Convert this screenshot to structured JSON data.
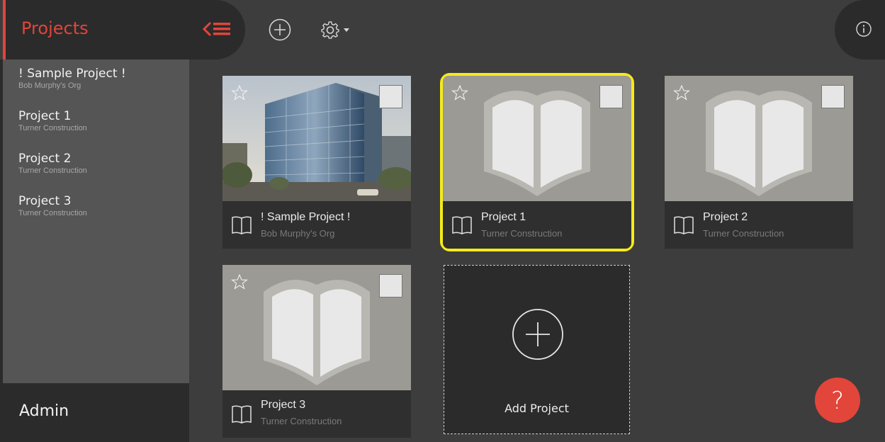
{
  "header": {
    "title": "Projects",
    "collapse_icon": "collapse-menu-icon",
    "add_icon": "plus-circle-icon",
    "settings_icon": "gear-dropdown-icon",
    "info_icon": "info-icon"
  },
  "sidebar": {
    "items": [
      {
        "name": "! Sample Project !",
        "org": "Bob Murphy's Org"
      },
      {
        "name": "Project 1",
        "org": "Turner Construction"
      },
      {
        "name": "Project 2",
        "org": "Turner Construction"
      },
      {
        "name": "Project 3",
        "org": "Turner Construction"
      }
    ],
    "admin_label": "Admin"
  },
  "cards": [
    {
      "name": "! Sample Project !",
      "org": "Bob Murphy's Org",
      "thumb": "building-photo",
      "selected": false
    },
    {
      "name": "Project 1",
      "org": "Turner Construction",
      "thumb": "book-icon",
      "selected": true
    },
    {
      "name": "Project 2",
      "org": "Turner Construction",
      "thumb": "book-icon",
      "selected": false
    },
    {
      "name": "Project 3",
      "org": "Turner Construction",
      "thumb": "book-icon",
      "selected": false
    }
  ],
  "add_project": {
    "label": "Add Project"
  },
  "help": {
    "label": "?"
  },
  "colors": {
    "accent": "#e2453a",
    "selected_outline": "#f5ea1a",
    "background": "#3d3d3d",
    "sidebar": "#555556",
    "dark": "#2b2b2b"
  }
}
